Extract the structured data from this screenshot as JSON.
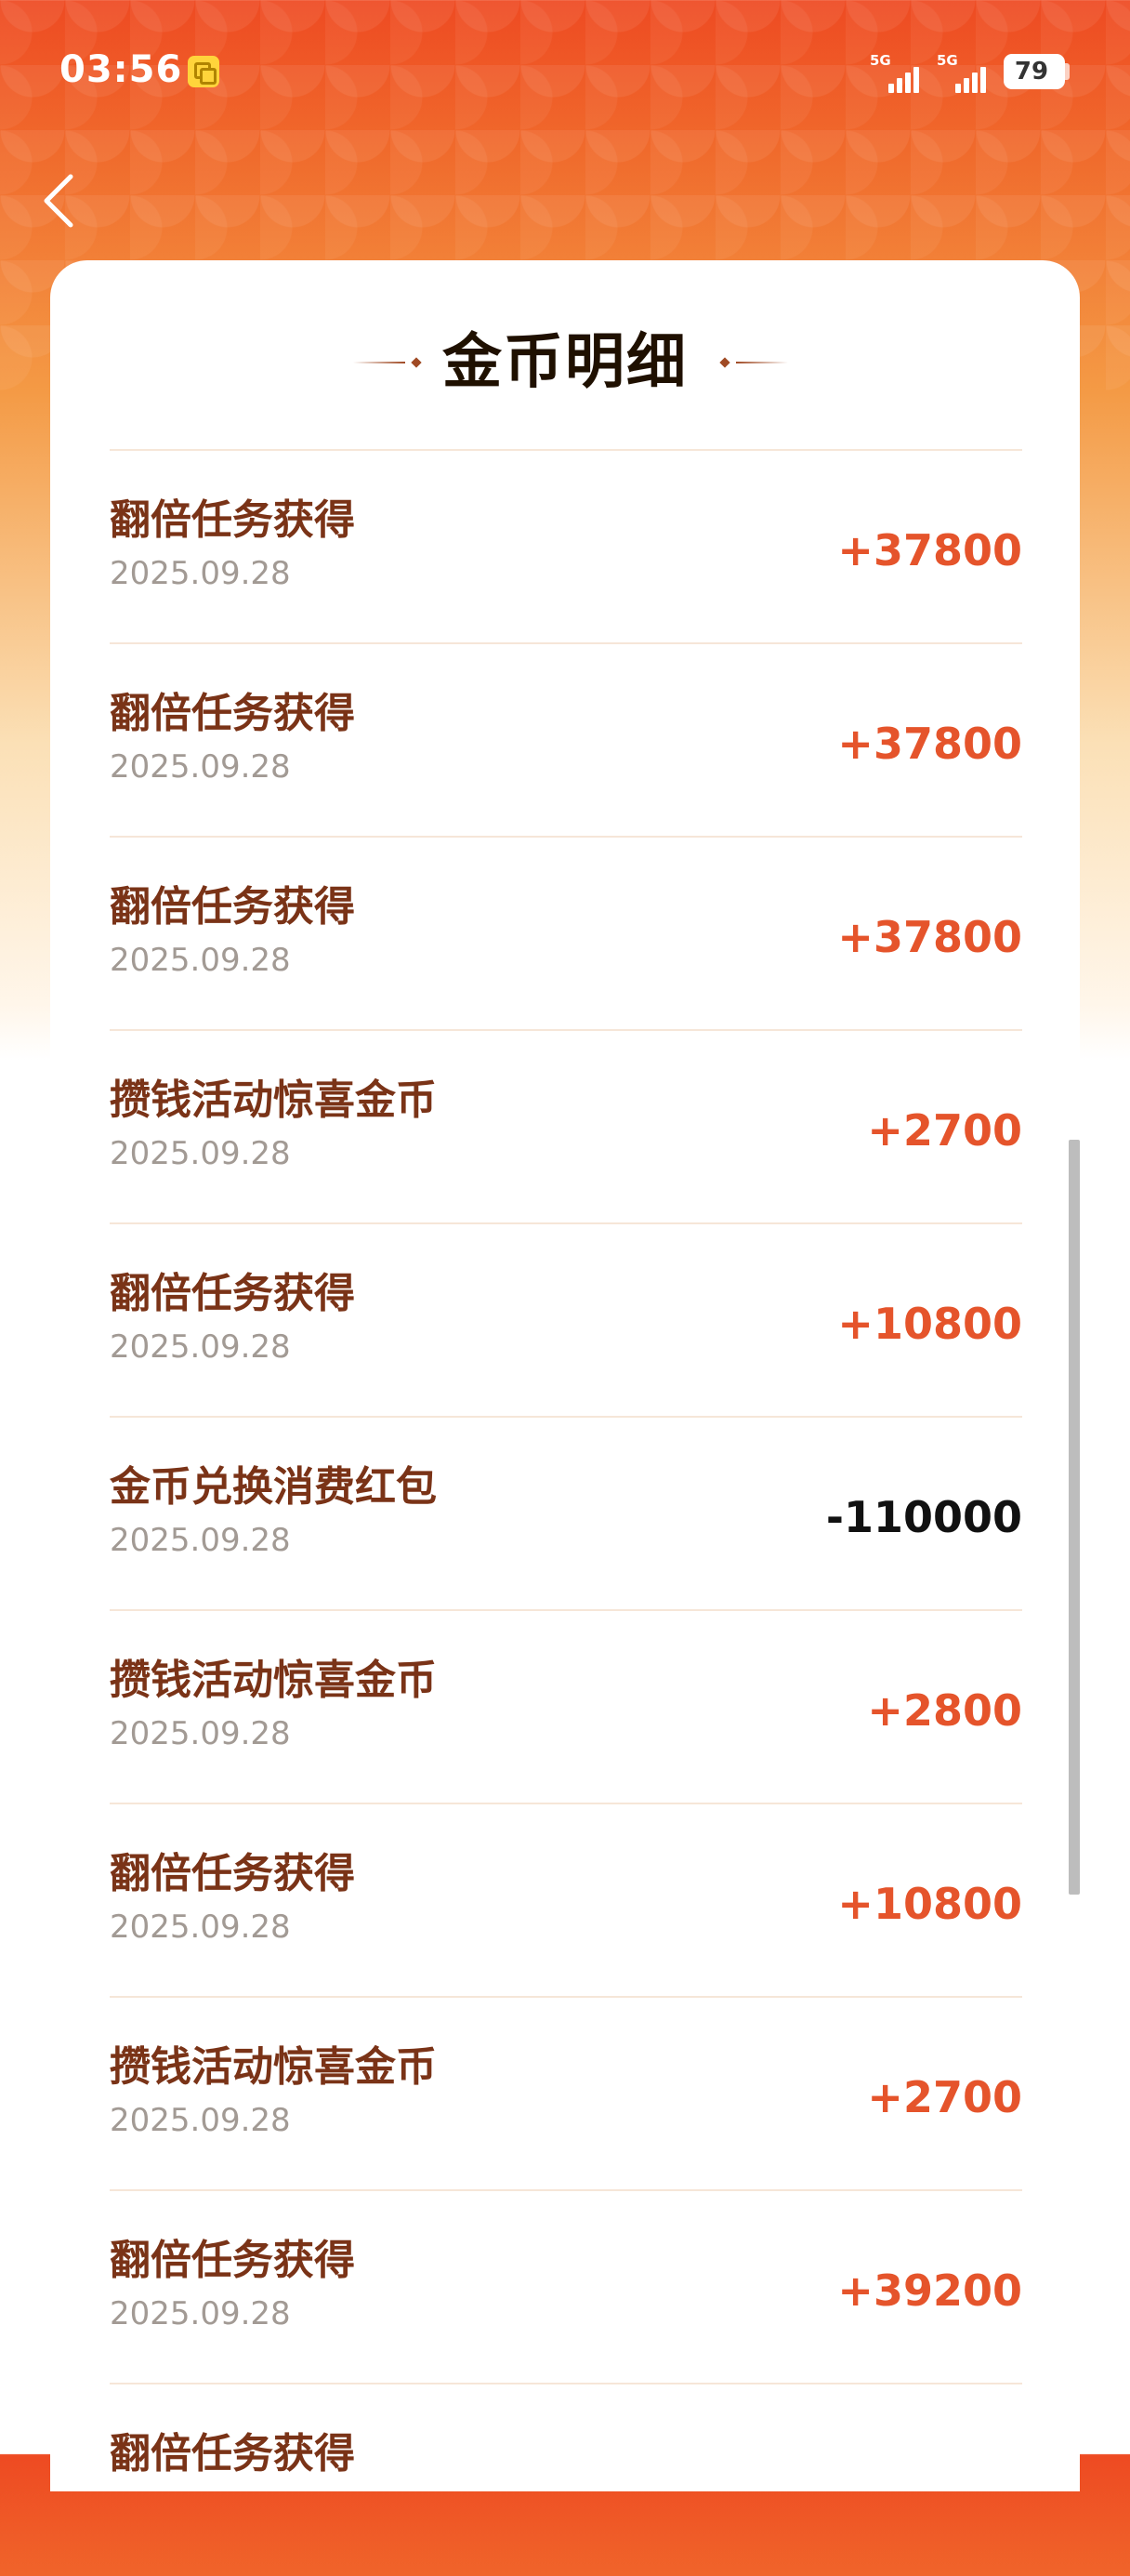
{
  "status_bar": {
    "time": "03:56",
    "network_1": "5G",
    "network_2": "5G",
    "battery": "79"
  },
  "icons": {
    "back": "chevron-left-icon",
    "notification": "copy-notification-icon"
  },
  "colors": {
    "accent": "#e5542b",
    "title_text": "#7a3317",
    "negative_text": "#111111",
    "header_gradient_top": "#ee4a22"
  },
  "page": {
    "title": "金币明细"
  },
  "transactions": [
    {
      "title": "翻倍任务获得",
      "date": "2025.09.28",
      "amount": "+37800"
    },
    {
      "title": "翻倍任务获得",
      "date": "2025.09.28",
      "amount": "+37800"
    },
    {
      "title": "翻倍任务获得",
      "date": "2025.09.28",
      "amount": "+37800"
    },
    {
      "title": "攒钱活动惊喜金币",
      "date": "2025.09.28",
      "amount": "+2700"
    },
    {
      "title": "翻倍任务获得",
      "date": "2025.09.28",
      "amount": "+10800"
    },
    {
      "title": "金币兑换消费红包",
      "date": "2025.09.28",
      "amount": "-110000"
    },
    {
      "title": "攒钱活动惊喜金币",
      "date": "2025.09.28",
      "amount": "+2800"
    },
    {
      "title": "翻倍任务获得",
      "date": "2025.09.28",
      "amount": "+10800"
    },
    {
      "title": "攒钱活动惊喜金币",
      "date": "2025.09.28",
      "amount": "+2700"
    },
    {
      "title": "翻倍任务获得",
      "date": "2025.09.28",
      "amount": "+39200"
    },
    {
      "title": "翻倍任务获得",
      "date": "",
      "amount": ""
    }
  ]
}
